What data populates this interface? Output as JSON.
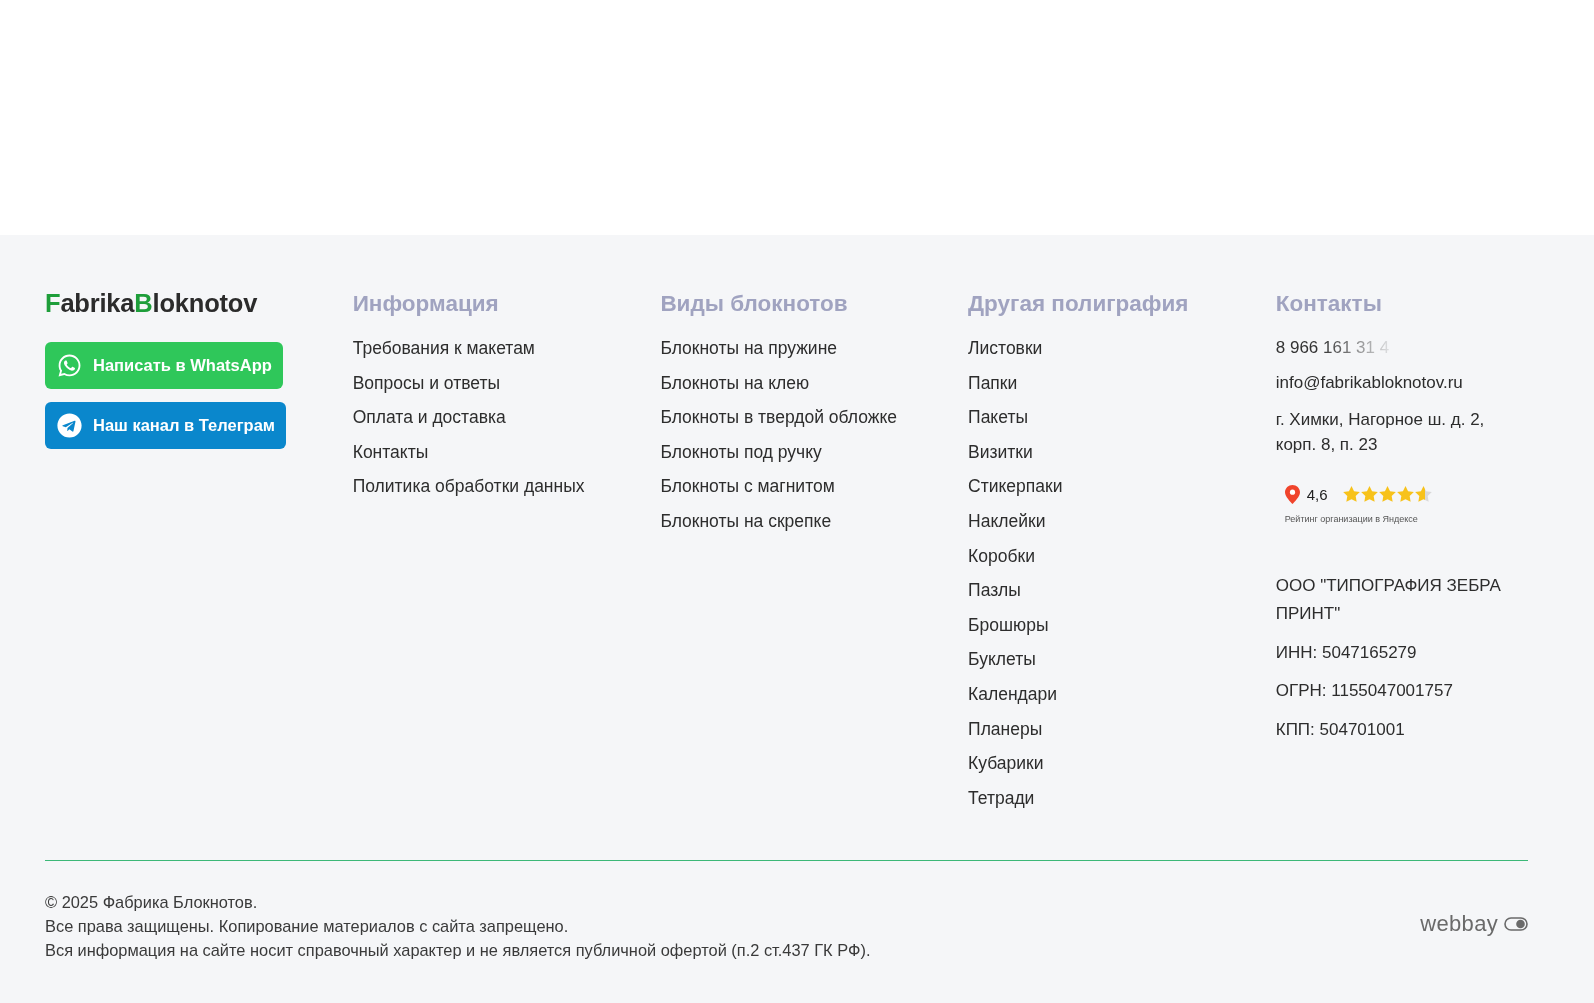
{
  "logo": {
    "parts": [
      {
        "text": "F",
        "accent": true
      },
      {
        "text": "abrika",
        "accent": false
      },
      {
        "text": "B",
        "accent": true
      },
      {
        "text": "loknotov",
        "accent": false
      }
    ]
  },
  "buttons": [
    {
      "label": "Написать в WhatsApp",
      "kind": "whatsapp"
    },
    {
      "label": "Наш канал в Телеграм",
      "kind": "telegram"
    }
  ],
  "columns": [
    {
      "title": "Информация",
      "links": [
        "Требования к макетам",
        "Вопросы и ответы",
        "Оплата и доставка",
        "Контакты",
        "Политика обработки данных"
      ]
    },
    {
      "title": "Виды блокнотов",
      "links": [
        "Блокноты на пружине",
        "Блокноты на клею",
        "Блокноты в твердой обложке",
        "Блокноты под ручку",
        "Блокноты с магнитом",
        "Блокноты на скрепке"
      ]
    },
    {
      "title": "Другая полиграфия",
      "links": [
        "Листовки",
        "Папки",
        "Пакеты",
        "Визитки",
        "Стикерпаки",
        "Наклейки",
        "Коробки",
        "Пазлы",
        "Брошюры",
        "Буклеты",
        "Календари",
        "Планеры",
        "Кубарики",
        "Тетради"
      ]
    }
  ],
  "contacts": {
    "title": "Контакты",
    "phone": {
      "text": "8 966 161 31 4",
      "faded": true
    },
    "email": "info@fabrikabloknotov.ru",
    "address": "г. Химки, Нагорное ш. д. 2, корп. 8, п. 23",
    "rating": {
      "value": "4,6",
      "stars": 4.6,
      "caption": "Рейтинг организации в Яндексе"
    },
    "company": "ООО \"ТИПОГРАФИЯ ЗЕБРА ПРИНТ\"",
    "details": [
      "ИНН: 5047165279",
      "ОГРН: 1155047001757",
      "КПП: 504701001"
    ]
  },
  "copyright": [
    "© 2025 Фабрика Блокнотов.",
    "Все права защищены. Копирование материалов с сайта запрещено.",
    "Вся информация на сайте носит справочный характер и не является публичной офертой (п.2 ст.437 ГК РФ)."
  ],
  "developer": {
    "name": "webbay"
  }
}
